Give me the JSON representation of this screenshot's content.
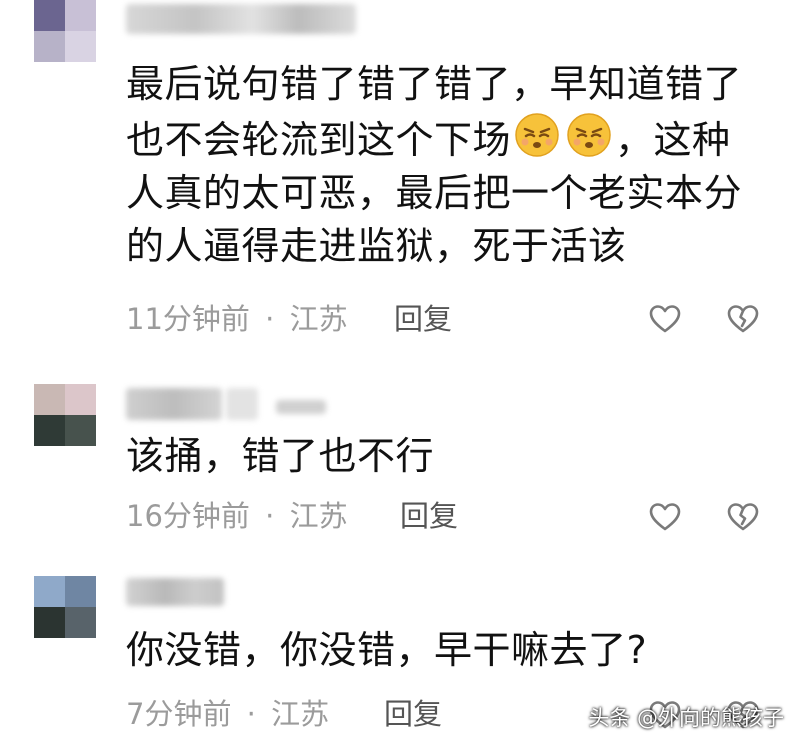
{
  "comments": [
    {
      "text": "最后说句错了错了错了，早知道错了也不会轮流到这个下场",
      "text_after_emoji": "，这种人真的太可恶，最后把一个老实本分的人逼得走进监狱，死于活该",
      "emoji_count": 2,
      "emoji_icon": "suffering-face-emoji",
      "time": "11分钟前",
      "separator": "·",
      "location": "江苏",
      "reply_label": "回复"
    },
    {
      "text": "该捅，错了也不行",
      "time": "16分钟前",
      "separator": "·",
      "location": "江苏",
      "reply_label": "回复"
    },
    {
      "text": "你没错，你没错，早干嘛去了?",
      "time": "7分钟前",
      "separator": "·",
      "location": "江苏",
      "reply_label": "回复"
    }
  ],
  "icons": {
    "like": "heart-outline-icon",
    "dislike": "broken-heart-icon"
  },
  "watermark": "头条 @外向的熊孩子",
  "colors": {
    "text": "#111111",
    "meta": "#9b9b9b",
    "icon": "#7a7a7a"
  }
}
